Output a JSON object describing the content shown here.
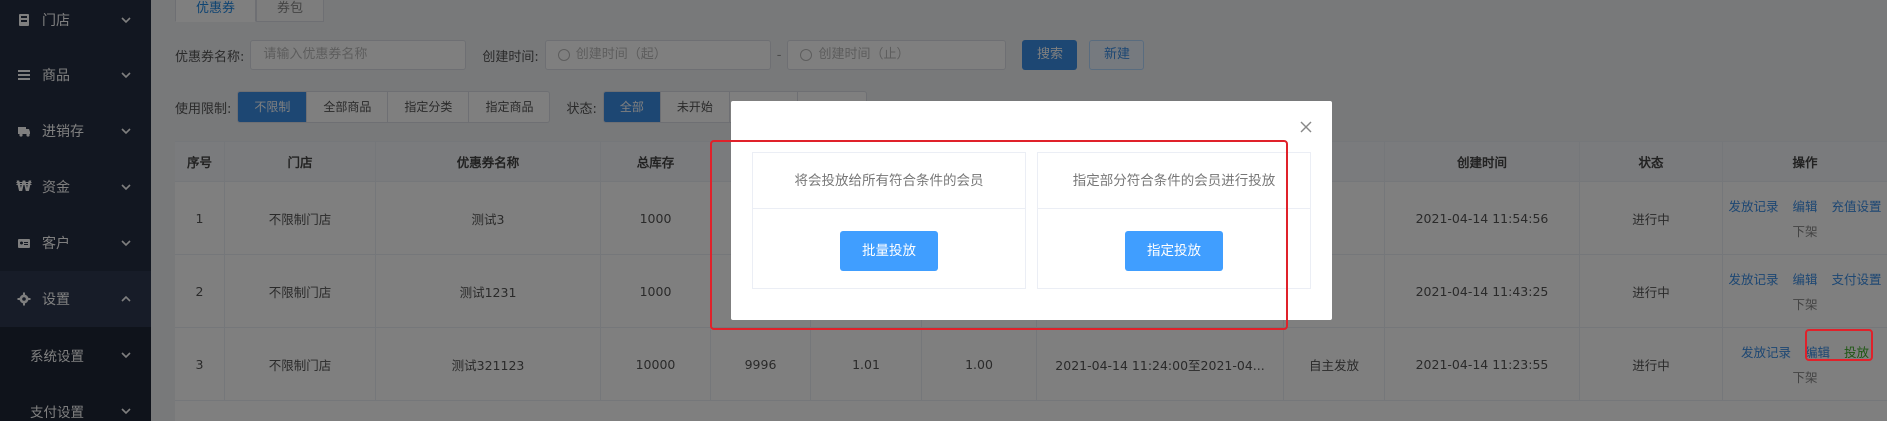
{
  "sidebar": {
    "items": [
      {
        "label": "门店",
        "icon": "store-icon"
      },
      {
        "label": "商品",
        "icon": "list-icon"
      },
      {
        "label": "进销存",
        "icon": "truck-icon"
      },
      {
        "label": "资金",
        "icon": "won-icon"
      },
      {
        "label": "客户",
        "icon": "id-card-icon"
      },
      {
        "label": "设置",
        "icon": "gear-icon"
      }
    ],
    "sub_items": [
      {
        "label": "系统设置"
      },
      {
        "label": "支付设置"
      }
    ]
  },
  "tabs": [
    {
      "label": "优惠券",
      "active": true
    },
    {
      "label": "券包",
      "active": false
    }
  ],
  "filters": {
    "coupon_name_label": "优惠券名称:",
    "coupon_name_placeholder": "请输入优惠券名称",
    "created_label": "创建时间:",
    "start_placeholder": "创建时间（起）",
    "dash": "-",
    "end_placeholder": "创建时间（止）",
    "search_btn": "搜索",
    "new_btn": "新建",
    "usage_label": "使用限制:",
    "usage_options": [
      "不限制",
      "全部商品",
      "指定分类",
      "指定商品"
    ],
    "status_label": "状态:",
    "status_options": [
      "全部",
      "未开始",
      "",
      ""
    ]
  },
  "table": {
    "headers": [
      "序号",
      "门店",
      "优惠券名称",
      "总库存",
      "",
      "",
      "",
      "",
      "",
      "创建时间",
      "状态",
      "操作"
    ],
    "rows": [
      {
        "cells": [
          "1",
          "不限制门店",
          "测试3",
          "1000",
          "",
          "",
          "",
          "",
          "",
          "2021-04-14 11:54:56",
          "进行中"
        ],
        "ops": [
          "发放记录",
          "编辑",
          "充值设置"
        ],
        "down": "下架"
      },
      {
        "cells": [
          "2",
          "不限制门店",
          "测试1231",
          "1000",
          "",
          "",
          "",
          "",
          "",
          "2021-04-14 11:43:25",
          "进行中"
        ],
        "ops": [
          "发放记录",
          "编辑",
          "支付设置"
        ],
        "down": "下架"
      },
      {
        "cells": [
          "3",
          "不限制门店",
          "测试321123",
          "10000",
          "9996",
          "1.01",
          "1.00",
          "2021-04-14 11:24:00至2021-04...",
          "自主发放",
          "2021-04-14 11:23:55",
          "进行中"
        ],
        "ops": [
          "发放记录",
          "编辑",
          "投放"
        ],
        "down": "下架"
      }
    ]
  },
  "modal": {
    "left_desc": "将会投放给所有符合条件的会员",
    "left_btn": "批量投放",
    "right_desc": "指定部分符合条件的会员进行投放",
    "right_btn": "指定投放"
  },
  "colors": {
    "sidebar_bg": "#252e42",
    "primary": "#409eff",
    "highlight": "#e0212a",
    "link_green": "#3fae29"
  }
}
